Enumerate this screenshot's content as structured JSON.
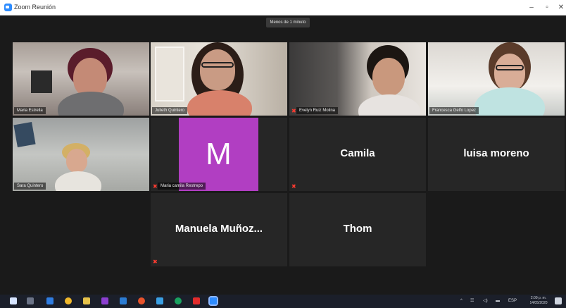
{
  "window": {
    "title": "Zoom Reunión",
    "minimize": "–",
    "maximize": "▫",
    "close": "✕"
  },
  "meeting": {
    "timer_banner": "Menos de 1 minuto"
  },
  "participants": [
    {
      "name": "Maria Estrella",
      "video": true
    },
    {
      "name": "Julieth Quintero",
      "video": true
    },
    {
      "name": "Evelyn Ruiz Molina",
      "video": true,
      "muted": true
    },
    {
      "name": "Francesca Gelfo Lopez",
      "video": true
    },
    {
      "name": "Sara Quintero",
      "video": true,
      "active_speaker": true
    },
    {
      "name": "Maria camila Restrepo",
      "video": false,
      "avatar_letter": "M",
      "avatar_color": "#b13ec2",
      "muted": true
    },
    {
      "name": "Camila",
      "video": false,
      "muted": true
    },
    {
      "name": "luisa moreno",
      "video": false
    },
    {
      "name": "Manuela  Muñoz...",
      "video": false,
      "muted": true
    },
    {
      "name": "Thom",
      "video": false
    }
  ],
  "taskbar": {
    "tray_language": "ESP",
    "clock_time": "2:09 p. m.",
    "clock_date": "14/05/2020"
  },
  "colors": {
    "meeting_bg": "#1a1a1a",
    "tile_bg": "#262626",
    "active_speaker_border": "#a7c34a",
    "mute_red": "#ff3b30",
    "zoom_blue": "#2d8cff"
  }
}
